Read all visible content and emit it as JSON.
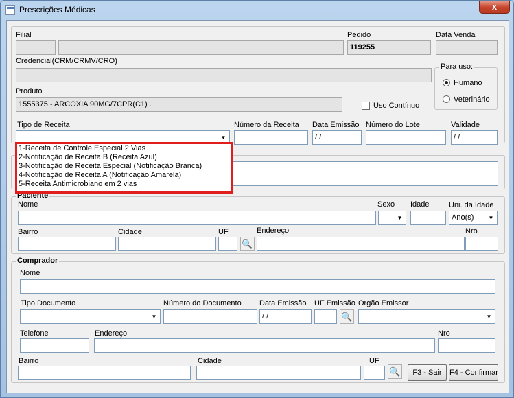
{
  "window": {
    "title": "Prescrições Médicas",
    "close_label": "x"
  },
  "labels": {
    "filial": "Filial",
    "pedido": "Pedido",
    "data_venda": "Data Venda",
    "credencial": "Credencial(CRM/CRMV/CRO)",
    "produto": "Produto",
    "uso_continuo": "Uso Contínuo",
    "tipo_receita": "Tipo de Receita",
    "numero_receita": "Número da Receita",
    "data_emissao": "Data Emissão",
    "numero_lote": "Número do Lote",
    "validade": "Validade"
  },
  "values": {
    "pedido": "119255",
    "produto": "1555375 - ARCOXIA 90MG/7CPR(C1) .",
    "data_emissao": " /  /",
    "validade": " /  /"
  },
  "para_uso": {
    "title": "Para uso:",
    "options": [
      "Humano",
      "Veterinário"
    ],
    "selected": "Humano"
  },
  "tipo_receita_options": [
    "1-Receita de Controle Especial 2 Vias",
    "2-Notificação de Receita B (Receita Azul)",
    "3-Notificação de Receita Especial (Notificação Branca)",
    "4-Notificação de Receita A (Notificação Amarela)",
    "5-Receita Antimicrobiano em 2 vias"
  ],
  "paciente": {
    "title": "Paciente",
    "nome": "Nome",
    "sexo": "Sexo",
    "idade": "Idade",
    "uni_idade": "Uni. da Idade",
    "uni_idade_value": "Ano(s)",
    "bairro": "Bairro",
    "cidade": "Cidade",
    "uf": "UF",
    "endereco": "Endereço",
    "nro": "Nro"
  },
  "comprador": {
    "title": "Comprador",
    "nome": "Nome",
    "tipo_documento": "Tipo Documento",
    "numero_documento": "Número do Documento",
    "data_emissao": "Data Emissão",
    "data_emissao_value": " /  /",
    "uf_emissao": "UF Emissão",
    "orgao_emissor": "Orgão Emissor",
    "telefone": "Telefone",
    "endereco": "Endereço",
    "nro": "Nro",
    "bairro": "Bairro",
    "cidade": "Cidade",
    "uf": "UF"
  },
  "buttons": {
    "sair": "F3 - Sair",
    "confirmar": "F4 - Confirmar"
  },
  "icons": {
    "window": "window-icon",
    "binoculars": "binoculars-icon"
  }
}
